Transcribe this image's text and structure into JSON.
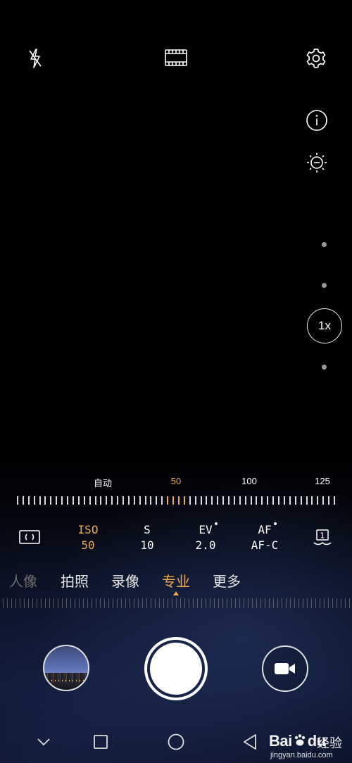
{
  "zoom": {
    "label": "1x"
  },
  "iso_scale": {
    "labels": [
      {
        "text": "自动",
        "active": false
      },
      {
        "text": "50",
        "active": true
      },
      {
        "text": "100",
        "active": false
      },
      {
        "text": "125",
        "active": false
      }
    ]
  },
  "params": [
    {
      "key": "ISO",
      "value": "50",
      "active": true,
      "has_dot": false
    },
    {
      "key": "S",
      "value": "10",
      "active": false,
      "has_dot": false
    },
    {
      "key": "EV",
      "value": "2.0",
      "active": false,
      "has_dot": true
    },
    {
      "key": "AF",
      "value": "AF-C",
      "active": false,
      "has_dot": true
    }
  ],
  "metering": {
    "icon": "metering-icon"
  },
  "wb_icon": {
    "label": "1"
  },
  "modes": [
    {
      "label": "人像",
      "active": false
    },
    {
      "label": "拍照",
      "active": false
    },
    {
      "label": "录像",
      "active": false
    },
    {
      "label": "专业",
      "active": true
    },
    {
      "label": "更多",
      "active": false
    }
  ],
  "watermark": {
    "brand_a": "Bai",
    "brand_b": "du",
    "cn": "经验",
    "url": "jingyan.baidu.com"
  },
  "colors": {
    "accent": "#f0a850",
    "text": "#ffffff"
  }
}
